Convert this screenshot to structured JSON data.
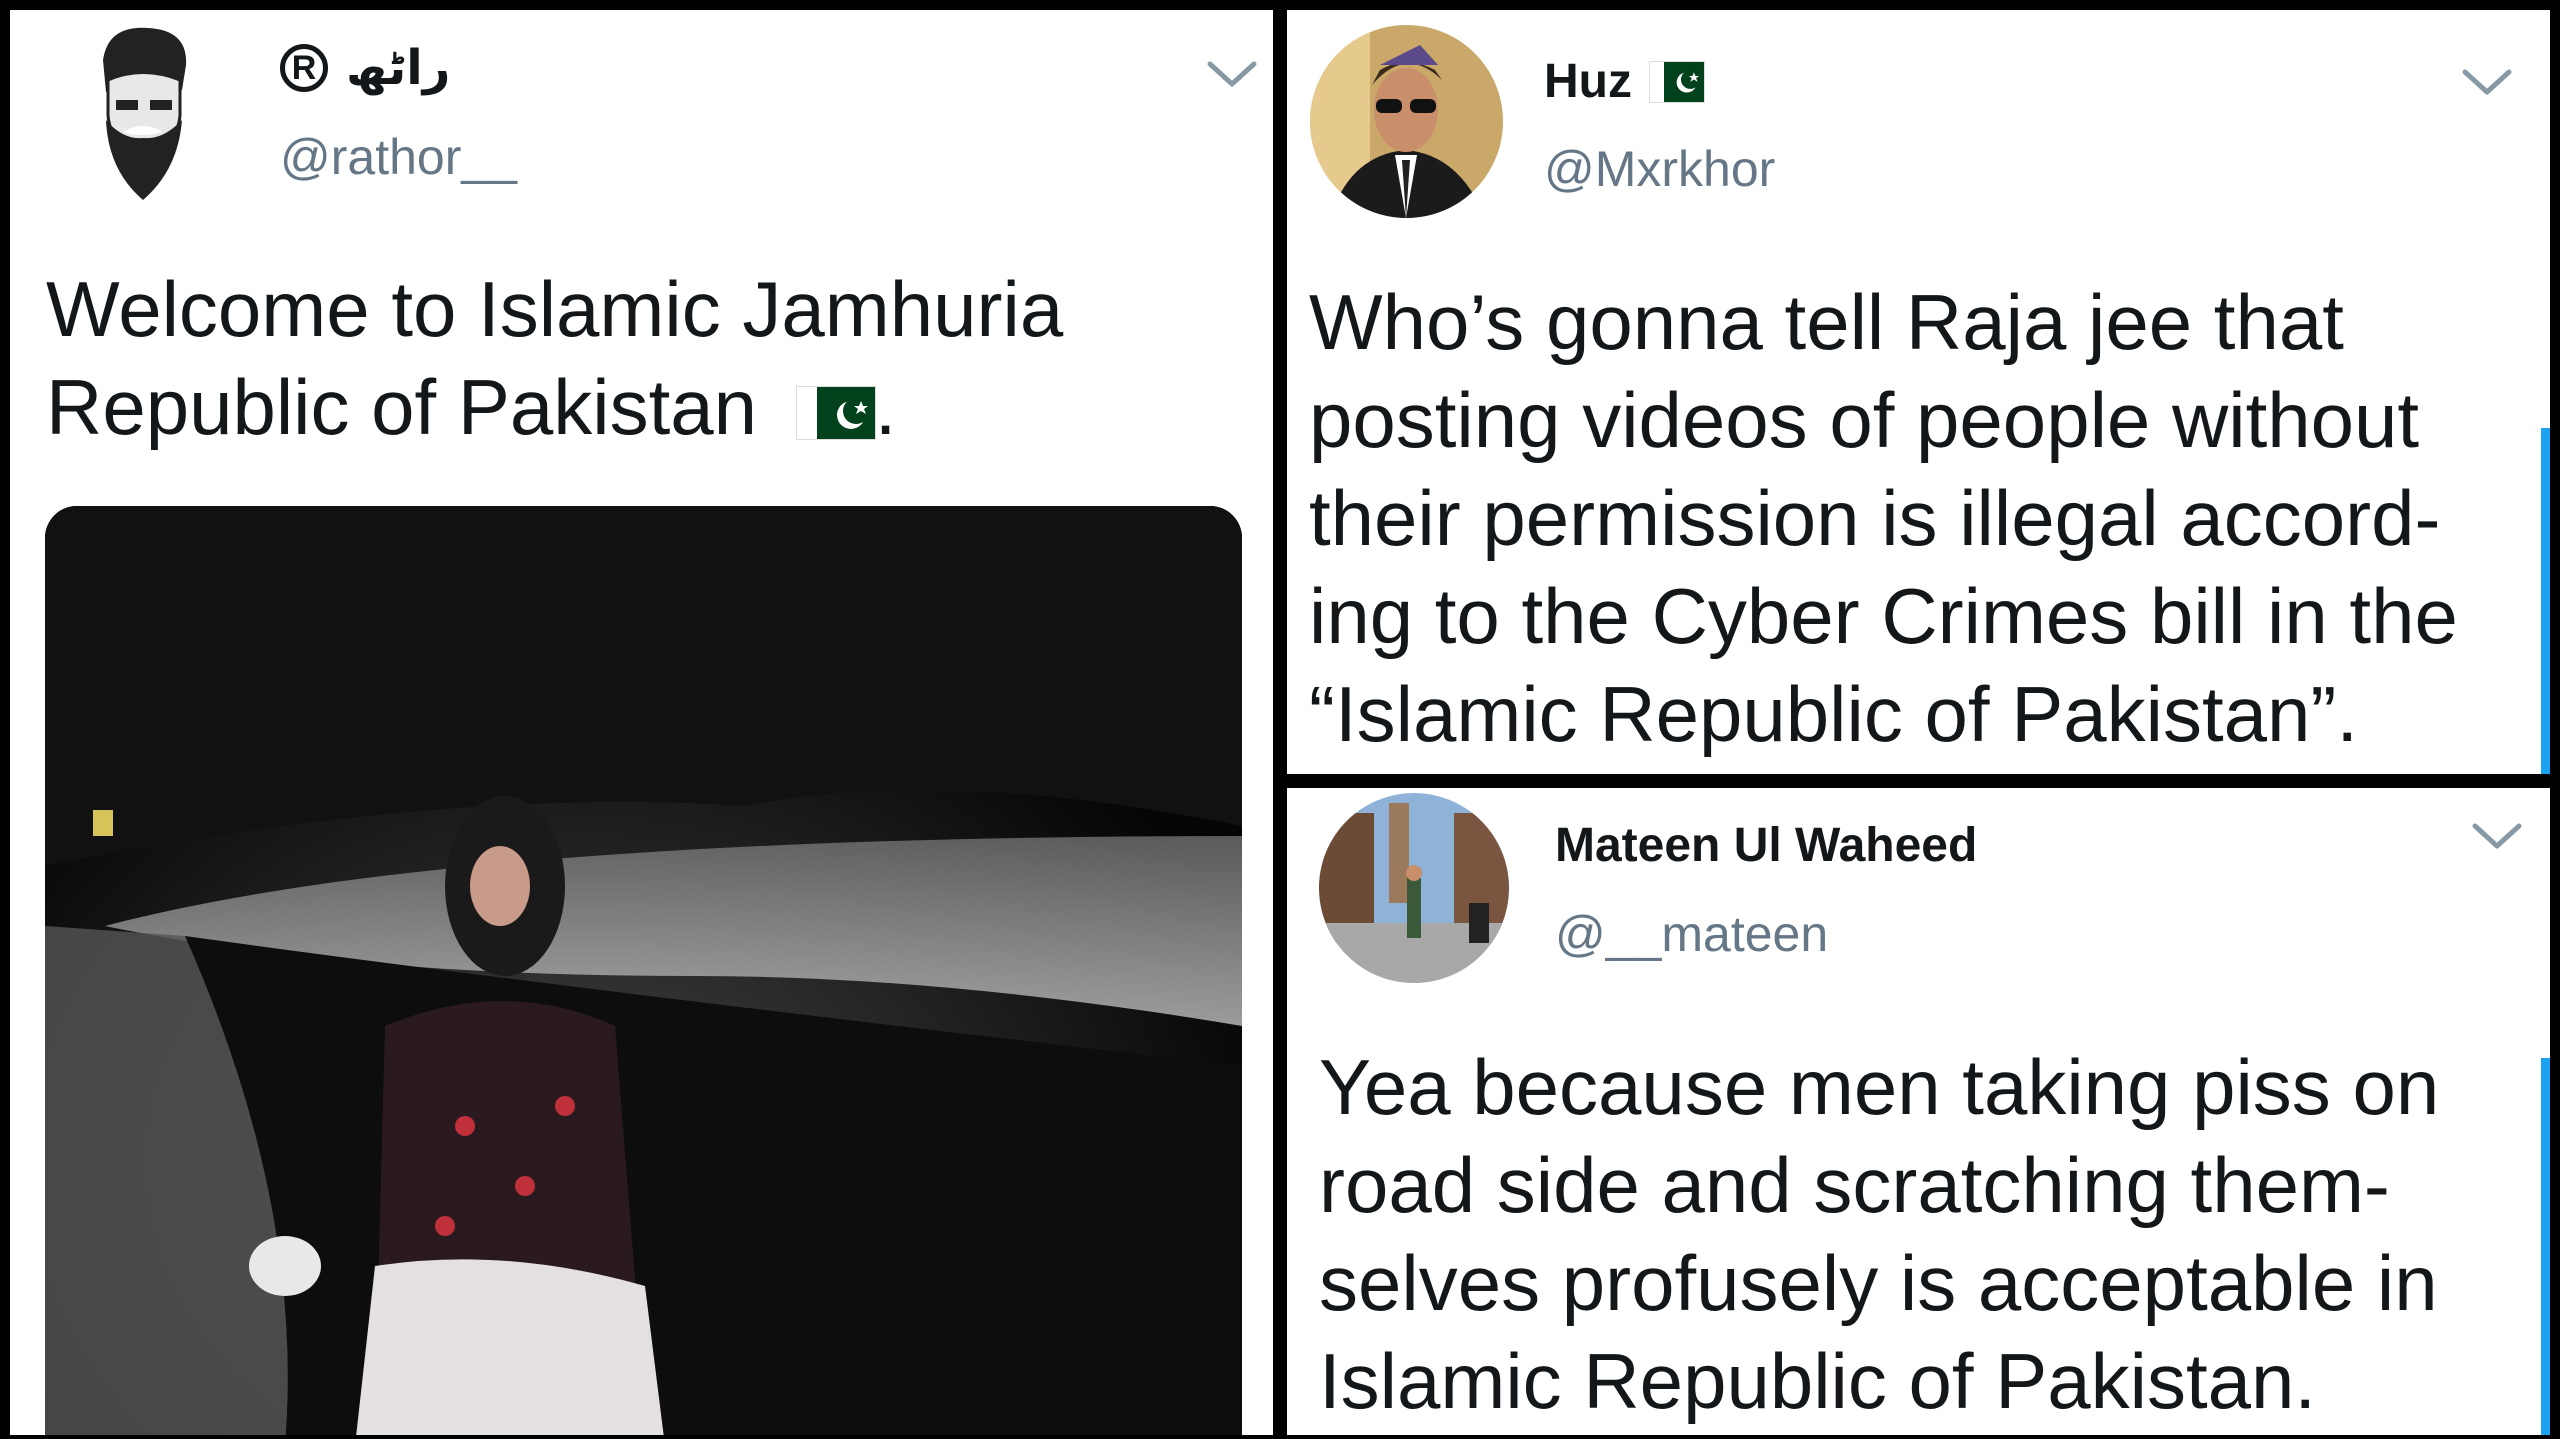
{
  "tweets": [
    {
      "name": "راٹھ",
      "handle": "@rathor__",
      "text_line1": "Welcome to Islamic Jamhuria",
      "text_line2": "Republic of Pakistan",
      "text_end": "."
    },
    {
      "name": "Huz",
      "handle": "@Mxrkhor",
      "lines": [
        "Who’s gonna tell Raja jee that",
        "posting videos of people without",
        "their permission is illegal accord-",
        "ing to the Cyber Crimes bill in the",
        "“Islamic Republic of Pakistan”."
      ]
    },
    {
      "name": "Mateen Ul Waheed",
      "handle": "@__mateen",
      "lines": [
        "Yea because men taking piss on",
        "road side and scratching them-",
        "selves profusely is acceptable in",
        "Islamic Republic of Pakistan."
      ]
    }
  ],
  "icons": {
    "registered": "registered-mark-icon",
    "flag": "pakistan-flag-icon",
    "chevron": "chevron-down-icon"
  },
  "colors": {
    "text": "#14171a",
    "secondary": "#657786",
    "flag_green": "#01411c",
    "accent": "#1da1f2"
  }
}
